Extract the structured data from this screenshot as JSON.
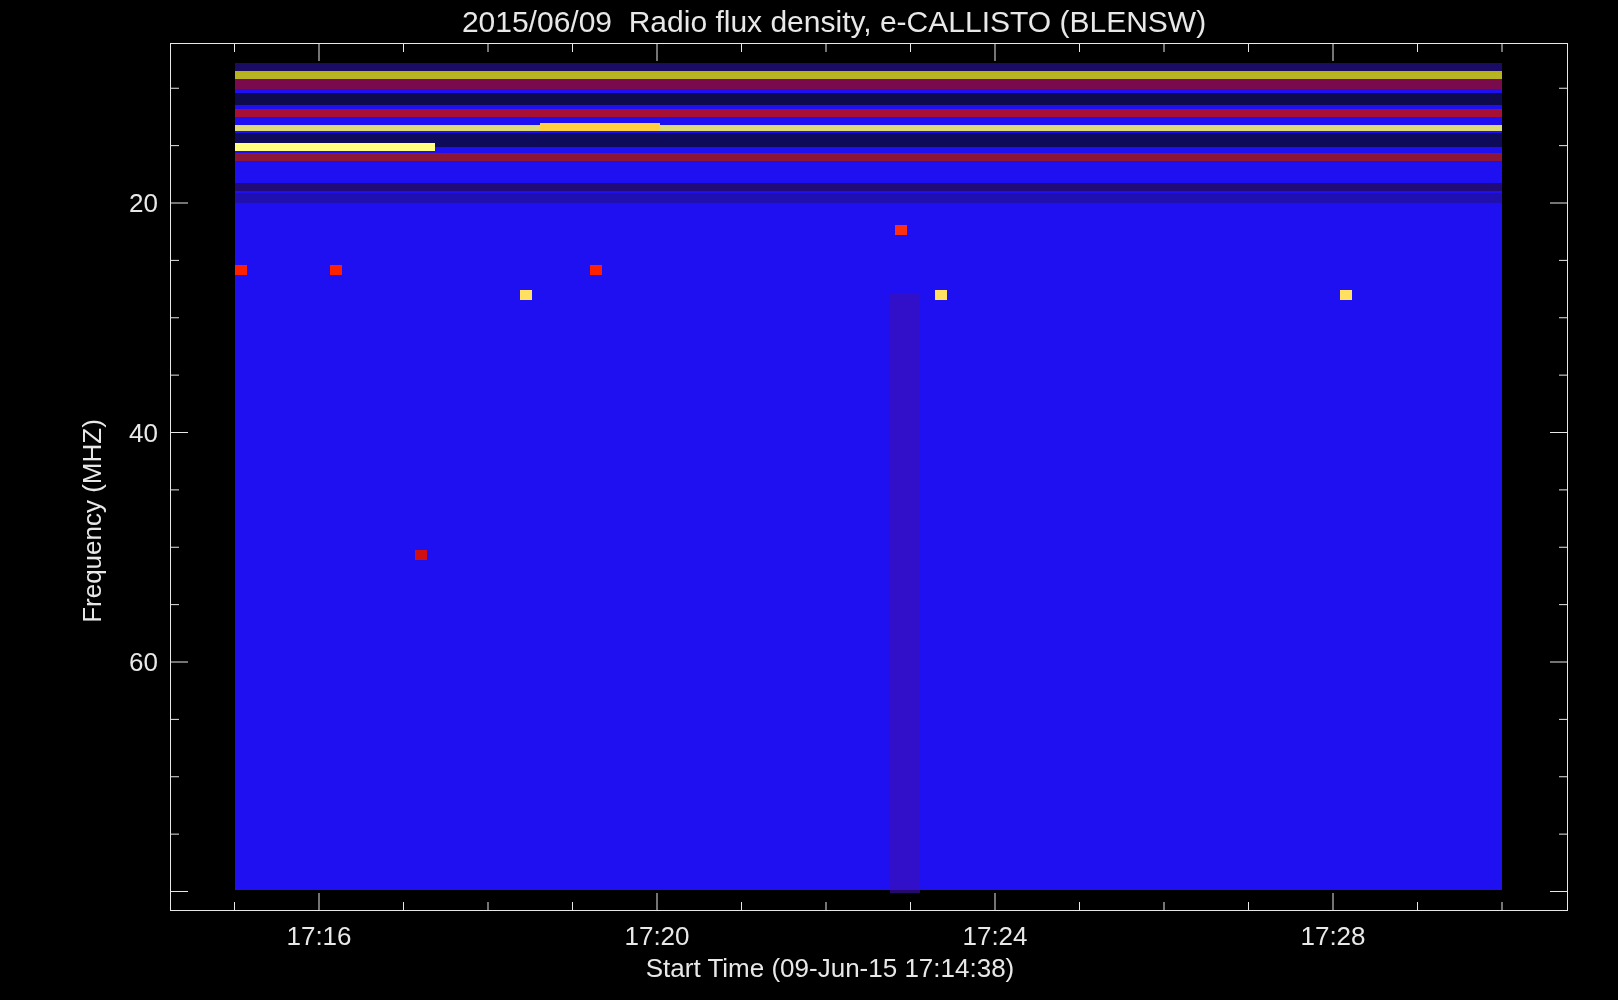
{
  "title": "2015/06/09  Radio flux density, e-CALLISTO (BLENSW)",
  "y_axis": {
    "label": "Frequency (MHZ)",
    "ticks": [
      "20",
      "40",
      "60"
    ]
  },
  "x_axis": {
    "label": "Start Time (09-Jun-15 17:14:38)",
    "ticks": [
      "17:16",
      "17:20",
      "17:24",
      "17:28"
    ]
  }
}
